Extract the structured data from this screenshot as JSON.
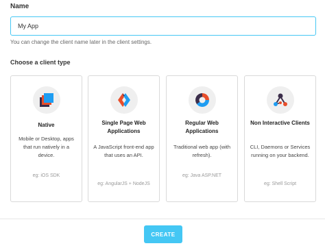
{
  "form": {
    "name_label": "Name",
    "name_value": "My App",
    "helper_text": "You can change the client name later in the client settings.",
    "section_title": "Choose a client type",
    "accent_color": "#44c7f4"
  },
  "cards": [
    {
      "title": "Native",
      "description": "Mobile or Desktop, apps that run natively in a device.",
      "example": "eg: iOS SDK",
      "icon": "stacked-squares-icon"
    },
    {
      "title": "Single Page Web Applications",
      "description": "A JavaScript front-end app that uses an API.",
      "example": "eg: AngularJS + NodeJS",
      "icon": "spa-angle-icon"
    },
    {
      "title": "Regular Web Applications",
      "description": "Traditional web app (with refresh).",
      "example": "eg: Java ASP.NET",
      "icon": "web-app-circle-icon"
    },
    {
      "title": "Non Interactive Clients",
      "description": "CLI, Daemons or Services running on your backend.",
      "example": "eg: Shell Script",
      "icon": "network-nodes-icon"
    }
  ],
  "footer": {
    "create_label": "CREATE"
  }
}
